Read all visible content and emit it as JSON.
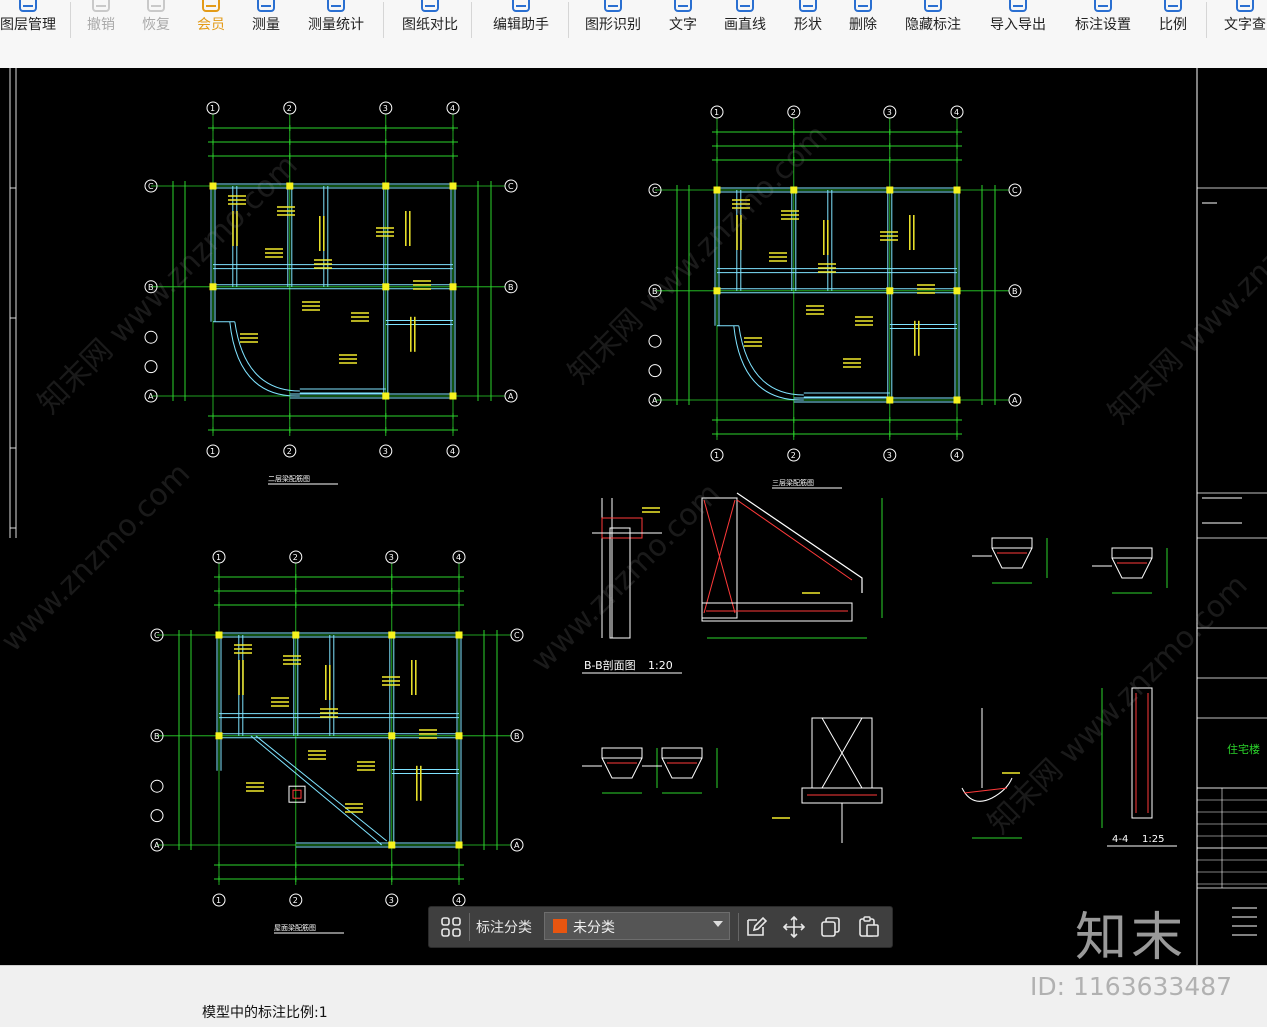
{
  "toolbar": {
    "items": [
      {
        "label": "图层管理",
        "state": "normal",
        "icon": "layers-icon"
      },
      {
        "label": "撤销",
        "state": "disabled",
        "icon": "undo-icon"
      },
      {
        "label": "恢复",
        "state": "disabled",
        "icon": "redo-icon"
      },
      {
        "label": "会员",
        "state": "vip",
        "icon": "vip-icon"
      },
      {
        "label": "测量",
        "state": "normal",
        "icon": "ruler-icon"
      },
      {
        "label": "测量统计",
        "state": "normal",
        "icon": "measure-stats-icon"
      },
      {
        "label": "图纸对比",
        "state": "normal",
        "icon": "compare-icon"
      },
      {
        "label": "编辑助手",
        "state": "normal",
        "icon": "edit-assistant-icon"
      },
      {
        "label": "图形识别",
        "state": "normal",
        "icon": "shape-recognize-icon"
      },
      {
        "label": "文字",
        "state": "normal",
        "icon": "text-icon"
      },
      {
        "label": "画直线",
        "state": "normal",
        "icon": "line-icon"
      },
      {
        "label": "形状",
        "state": "normal",
        "icon": "shape-icon"
      },
      {
        "label": "删除",
        "state": "normal",
        "icon": "eraser-icon"
      },
      {
        "label": "隐藏标注",
        "state": "normal",
        "icon": "hide-annotation-icon"
      },
      {
        "label": "导入导出",
        "state": "normal",
        "icon": "import-export-icon"
      },
      {
        "label": "标注设置",
        "state": "normal",
        "icon": "annotation-settings-icon"
      },
      {
        "label": "比例",
        "state": "normal",
        "icon": "scale-icon"
      },
      {
        "label": "文字查",
        "state": "normal",
        "icon": "text-search-icon"
      }
    ]
  },
  "drawing": {
    "plan1": {
      "axes_top": [
        "1",
        "2",
        "3",
        "4"
      ],
      "axes_left": [
        "C",
        "B",
        "A"
      ],
      "title": "二层梁配筋图"
    },
    "plan2": {
      "axes_top": [
        "1",
        "2",
        "3",
        "4"
      ],
      "axes_left": [
        "C",
        "B",
        "A"
      ],
      "title": "三层梁配筋图"
    },
    "plan3": {
      "axes_top": [
        "1",
        "2",
        "3",
        "4"
      ],
      "axes_left": [
        "C",
        "B",
        "A"
      ],
      "title": "屋面梁配筋图"
    },
    "section_bb": "B-B剖面图",
    "section_bb_scale": "1:20",
    "section_44": "4-4",
    "section_44_scale": "1:25",
    "title_block_name": "住宅楼"
  },
  "annotation_popup": {
    "label": "标注分类",
    "selected": "未分类",
    "swatch_color": "#e8550f"
  },
  "status": {
    "scale_text": "模型中的标注比例:1"
  },
  "watermark": {
    "brand": "知末",
    "id_text": "ID: 1163633487"
  },
  "colors": {
    "canvas_bg": "#000000",
    "beam": "#7fe3ff",
    "axis": "#2bd52b",
    "note": "#f2ea2c",
    "column": "#f6f21e",
    "red": "#ff3a3a",
    "white": "#ffffff"
  }
}
